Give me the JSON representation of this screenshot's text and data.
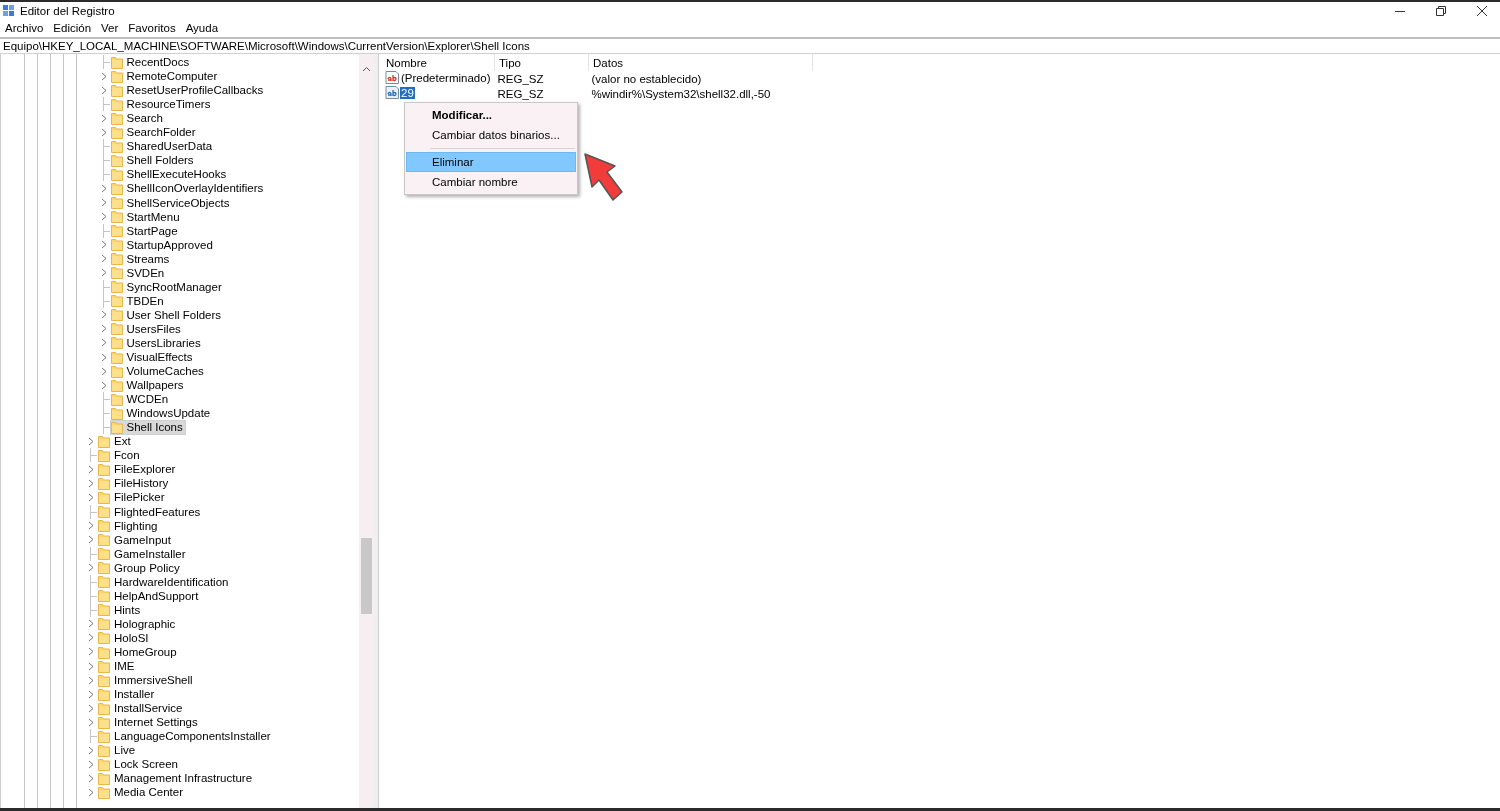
{
  "window": {
    "title": "Editor del Registro"
  },
  "menu": [
    "Archivo",
    "Edición",
    "Ver",
    "Favoritos",
    "Ayuda"
  ],
  "address": "Equipo\\HKEY_LOCAL_MACHINE\\SOFTWARE\\Microsoft\\Windows\\CurrentVersion\\Explorer\\Shell Icons",
  "tree": {
    "items": [
      {
        "children": [
          {
            "label": "RecentDocs",
            "expandable": false,
            "selected": false
          },
          {
            "label": "RemoteComputer",
            "expandable": true,
            "selected": false
          },
          {
            "label": "ResetUserProfileCallbacks",
            "expandable": true,
            "selected": false
          },
          {
            "label": "ResourceTimers",
            "expandable": false,
            "selected": false
          },
          {
            "label": "Search",
            "expandable": true,
            "selected": false
          },
          {
            "label": "SearchFolder",
            "expandable": true,
            "selected": false
          },
          {
            "label": "SharedUserData",
            "expandable": false,
            "selected": false
          },
          {
            "label": "Shell Folders",
            "expandable": false,
            "selected": false
          },
          {
            "label": "ShellExecuteHooks",
            "expandable": false,
            "selected": false
          },
          {
            "label": "ShellIconOverlayIdentifiers",
            "expandable": true,
            "selected": false
          },
          {
            "label": "ShellServiceObjects",
            "expandable": true,
            "selected": false
          },
          {
            "label": "StartMenu",
            "expandable": true,
            "selected": false
          },
          {
            "label": "StartPage",
            "expandable": false,
            "selected": false
          },
          {
            "label": "StartupApproved",
            "expandable": true,
            "selected": false
          },
          {
            "label": "Streams",
            "expandable": true,
            "selected": false
          },
          {
            "label": "SVDEn",
            "expandable": true,
            "selected": false
          },
          {
            "label": "SyncRootManager",
            "expandable": false,
            "selected": false
          },
          {
            "label": "TBDEn",
            "expandable": false,
            "selected": false
          },
          {
            "label": "User Shell Folders",
            "expandable": true,
            "selected": false
          },
          {
            "label": "UsersFiles",
            "expandable": true,
            "selected": false
          },
          {
            "label": "UsersLibraries",
            "expandable": true,
            "selected": false
          },
          {
            "label": "VisualEffects",
            "expandable": true,
            "selected": false
          },
          {
            "label": "VolumeCaches",
            "expandable": true,
            "selected": false
          },
          {
            "label": "Wallpapers",
            "expandable": true,
            "selected": false
          },
          {
            "label": "WCDEn",
            "expandable": false,
            "selected": false
          },
          {
            "label": "WindowsUpdate",
            "expandable": false,
            "selected": false
          },
          {
            "label": "Shell Icons",
            "expandable": false,
            "selected": true
          }
        ]
      },
      {
        "label": "Ext",
        "expandable": true,
        "selected": false
      },
      {
        "label": "Fcon",
        "expandable": false,
        "selected": false
      },
      {
        "label": "FileExplorer",
        "expandable": true,
        "selected": false
      },
      {
        "label": "FileHistory",
        "expandable": true,
        "selected": false
      },
      {
        "label": "FilePicker",
        "expandable": true,
        "selected": false
      },
      {
        "label": "FlightedFeatures",
        "expandable": false,
        "selected": false
      },
      {
        "label": "Flighting",
        "expandable": true,
        "selected": false
      },
      {
        "label": "GameInput",
        "expandable": true,
        "selected": false
      },
      {
        "label": "GameInstaller",
        "expandable": false,
        "selected": false
      },
      {
        "label": "Group Policy",
        "expandable": true,
        "selected": false
      },
      {
        "label": "HardwareIdentification",
        "expandable": false,
        "selected": false
      },
      {
        "label": "HelpAndSupport",
        "expandable": false,
        "selected": false
      },
      {
        "label": "Hints",
        "expandable": false,
        "selected": false
      },
      {
        "label": "Holographic",
        "expandable": true,
        "selected": false
      },
      {
        "label": "HoloSI",
        "expandable": true,
        "selected": false
      },
      {
        "label": "HomeGroup",
        "expandable": true,
        "selected": false
      },
      {
        "label": "IME",
        "expandable": true,
        "selected": false
      },
      {
        "label": "ImmersiveShell",
        "expandable": true,
        "selected": false
      },
      {
        "label": "Installer",
        "expandable": true,
        "selected": false
      },
      {
        "label": "InstallService",
        "expandable": true,
        "selected": false
      },
      {
        "label": "Internet Settings",
        "expandable": true,
        "selected": false
      },
      {
        "label": "LanguageComponentsInstaller",
        "expandable": false,
        "selected": false
      },
      {
        "label": "Live",
        "expandable": true,
        "selected": false
      },
      {
        "label": "Lock Screen",
        "expandable": true,
        "selected": false
      },
      {
        "label": "Management Infrastructure",
        "expandable": true,
        "selected": false
      },
      {
        "label": "Media Center",
        "expandable": true,
        "selected": false
      }
    ]
  },
  "values": {
    "columns": [
      "Nombre",
      "Tipo",
      "Datos"
    ],
    "rows": [
      {
        "name": "(Predeterminado)",
        "type": "REG_SZ",
        "data": "(valor no establecido)",
        "selected": false
      },
      {
        "name": "29",
        "type": "REG_SZ",
        "data": "%windir%\\System32\\shell32.dll,-50",
        "selected": true
      }
    ]
  },
  "context_menu": {
    "items": [
      {
        "kind": "item",
        "label": "Modificar...",
        "default": true,
        "selected": false
      },
      {
        "kind": "item",
        "label": "Cambiar datos binarios...",
        "default": false,
        "selected": false
      },
      {
        "kind": "separator"
      },
      {
        "kind": "item",
        "label": "Eliminar",
        "default": false,
        "selected": true
      },
      {
        "kind": "item",
        "label": "Cambiar nombre",
        "default": false,
        "selected": false
      }
    ]
  }
}
